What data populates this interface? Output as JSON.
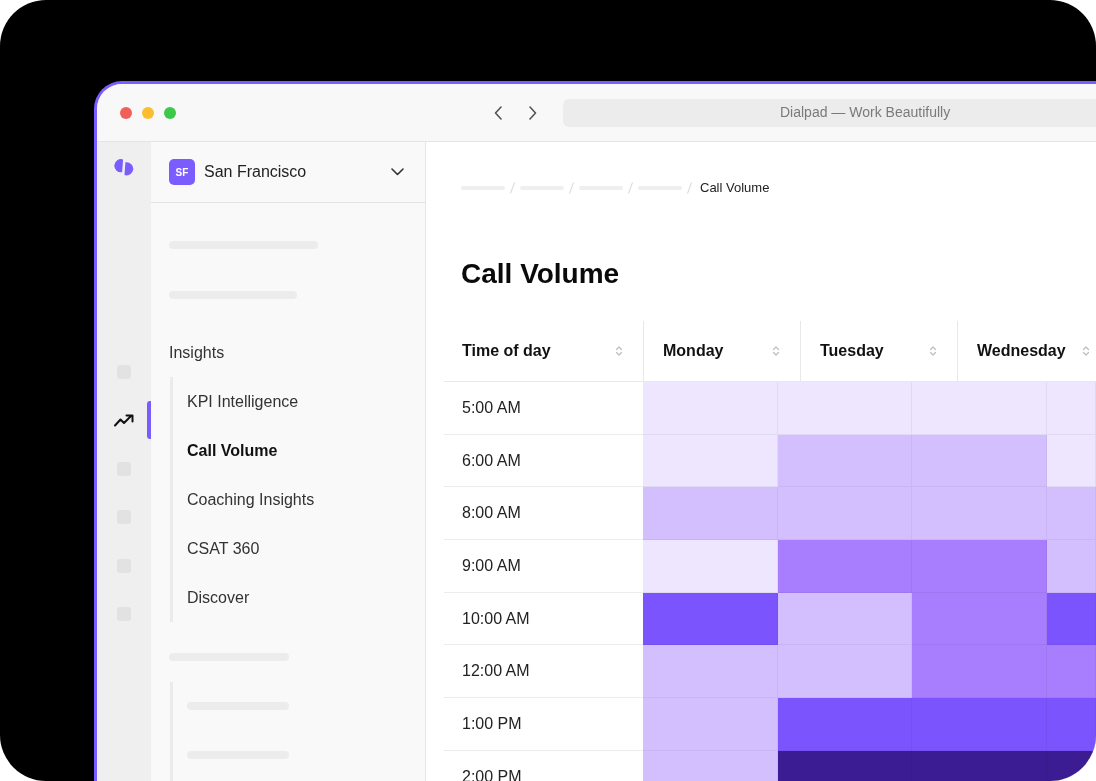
{
  "window": {
    "title": "Dialpad — Work Beautifully"
  },
  "rail_items": [
    {
      "kind": "placeholder",
      "selected": false
    },
    {
      "kind": "trend",
      "selected": true
    },
    {
      "kind": "placeholder",
      "selected": false
    },
    {
      "kind": "placeholder",
      "selected": false
    },
    {
      "kind": "placeholder",
      "selected": false
    },
    {
      "kind": "placeholder",
      "selected": false
    }
  ],
  "workspace": {
    "initials": "SF",
    "name": "San Francisco"
  },
  "sidebar": {
    "section": "Insights",
    "items": [
      {
        "label": "KPI Intelligence",
        "selected": false
      },
      {
        "label": "Call Volume",
        "selected": true
      },
      {
        "label": "Coaching Insights",
        "selected": false
      },
      {
        "label": "CSAT 360",
        "selected": false
      },
      {
        "label": "Discover",
        "selected": false
      }
    ]
  },
  "breadcrumb": {
    "current": "Call Volume"
  },
  "page_title": "Call Volume",
  "table": {
    "columns": [
      {
        "label": "Time of day"
      },
      {
        "label": "Monday"
      },
      {
        "label": "Tuesday"
      },
      {
        "label": "Wednesday"
      }
    ],
    "rows": [
      {
        "time": "5:00 AM",
        "cells": [
          {
            "color": "#ede6fe"
          },
          {
            "color": "#ede6fe"
          },
          {
            "color": "#ede6fe"
          },
          {
            "color": "#ede6fe"
          }
        ]
      },
      {
        "time": "6:00 AM",
        "cells": [
          {
            "color": "#ede6fe"
          },
          {
            "color": "#d4bffe"
          },
          {
            "color": "#d4bffe"
          },
          {
            "color": "#ede6fe"
          }
        ]
      },
      {
        "time": "8:00 AM",
        "cells": [
          {
            "color": "#d4bffe"
          },
          {
            "color": "#d4bffe"
          },
          {
            "color": "#d4bffe"
          },
          {
            "color": "#d4bffe"
          }
        ]
      },
      {
        "time": "9:00 AM",
        "cells": [
          {
            "color": "#ede6fe"
          },
          {
            "color": "#a97efe"
          },
          {
            "color": "#a97efe"
          },
          {
            "color": "#d4bffe"
          }
        ]
      },
      {
        "time": "10:00 AM",
        "cells": [
          {
            "color": "#7c54fe"
          },
          {
            "color": "#d4bffe"
          },
          {
            "color": "#a97efe"
          },
          {
            "color": "#7c54fe"
          }
        ]
      },
      {
        "time": "12:00 AM",
        "cells": [
          {
            "color": "#d4bffe"
          },
          {
            "color": "#d4bffe"
          },
          {
            "color": "#a97efe"
          },
          {
            "color": "#a97efe"
          }
        ]
      },
      {
        "time": "1:00 PM",
        "cells": [
          {
            "color": "#d4bffe"
          },
          {
            "color": "#7c54fe"
          },
          {
            "color": "#7c54fe"
          },
          {
            "color": "#7c54fe"
          }
        ]
      },
      {
        "time": "2:00 PM",
        "cells": [
          {
            "color": "#d4bffe"
          },
          {
            "color": "#3c1c92"
          },
          {
            "color": "#3c1c92"
          },
          {
            "color": "#3c1c92"
          }
        ]
      }
    ]
  }
}
